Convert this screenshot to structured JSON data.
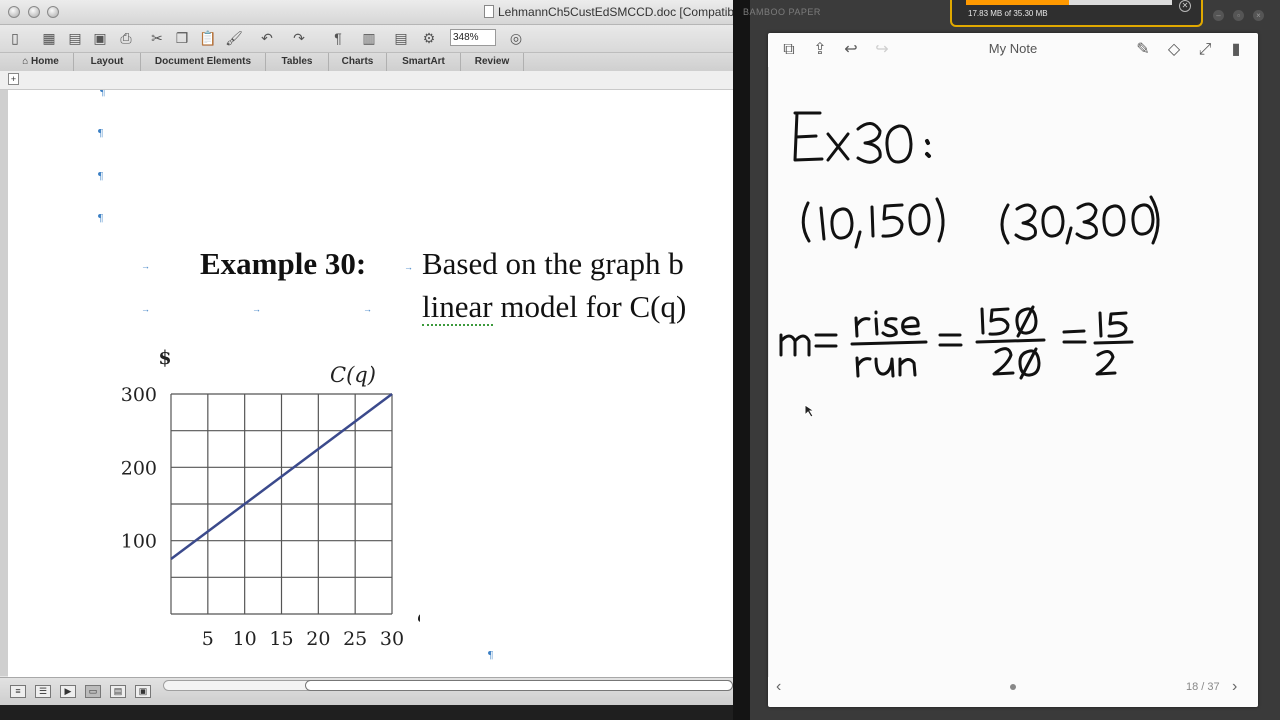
{
  "word": {
    "document_title": "LehmannCh5CustEdSMCCD.doc [Compatib",
    "zoom": "348%",
    "ribbon_tabs": [
      "Home",
      "Layout",
      "Document Elements",
      "Tables",
      "Charts",
      "SmartArt",
      "Review"
    ],
    "pilcrow": "¶",
    "tab_arrow": "→",
    "example_label": "Example 30:",
    "example_line1": "Based on the graph b",
    "example_line2_prefix": "linear model for C(q)",
    "example_line2_underlined": "linear"
  },
  "chart_data": {
    "type": "line",
    "title": "",
    "xlabel": "q",
    "ylabel": "$",
    "series": [
      {
        "name": "C(q)",
        "x": [
          0,
          30
        ],
        "y": [
          75,
          300
        ]
      }
    ],
    "x_ticks": [
      "5",
      "10",
      "15",
      "20",
      "25",
      "30"
    ],
    "y_ticks": [
      "100",
      "200",
      "300"
    ],
    "xlim": [
      0,
      30
    ],
    "ylim": [
      0,
      300
    ],
    "grid": true,
    "line_color": "#3b4a8c"
  },
  "bamboo": {
    "brand": "BAMBOO PAPER",
    "download_text": "17.83 MB of 35.30 MB",
    "download_progress": 0.5,
    "note_title": "My Note",
    "page_indicator": "18 / 37",
    "handwriting": {
      "line1": "Ex 30:",
      "line2": "(10,150)   (30,300)",
      "line3": "m = rise/run = 150/20 = 15/2"
    }
  }
}
